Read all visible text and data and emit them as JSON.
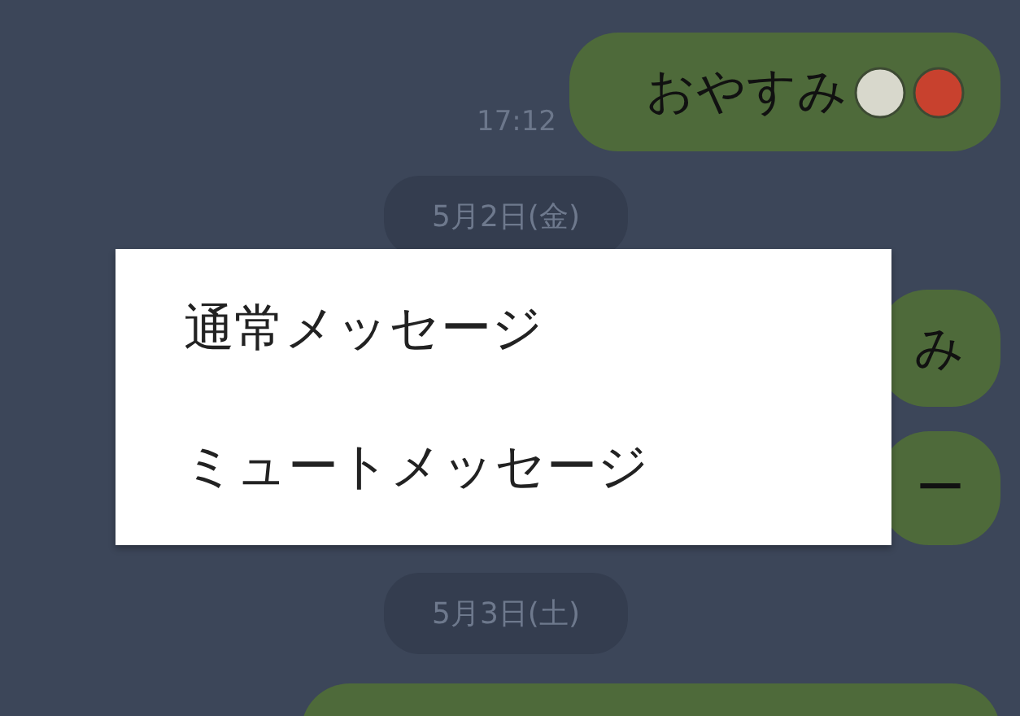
{
  "messages": [
    {
      "kind": "bubble",
      "text": "おやすみ",
      "time": "17:12",
      "emoji": [
        {
          "kind": "pale"
        },
        {
          "kind": "red"
        }
      ]
    },
    {
      "kind": "date",
      "text": "5月2日(金)"
    },
    {
      "kind": "bubble",
      "text": "み"
    },
    {
      "kind": "bubble",
      "text": "ー"
    },
    {
      "kind": "date",
      "text": "5月3日(土)"
    },
    {
      "kind": "bubble"
    }
  ],
  "menu": {
    "items": [
      {
        "label": "通常メッセージ"
      },
      {
        "label": "ミュートメッセージ"
      }
    ]
  }
}
